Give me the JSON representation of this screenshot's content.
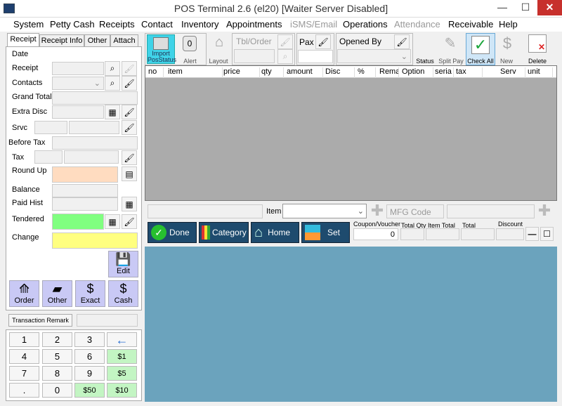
{
  "window": {
    "title": "POS Terminal 2.6 (el20) [Waiter Server Disabled]",
    "minimize": "—",
    "maximize": "☐",
    "close": "✕"
  },
  "menu": [
    "System",
    "Petty Cash",
    "Receipts",
    "Contact",
    "Inventory",
    "Appointments",
    "iSMS/Email",
    "Operations",
    "Attendance",
    "Receivable",
    "Help"
  ],
  "tabs": [
    "Receipt",
    "Receipt Info",
    "Other",
    "Attach"
  ],
  "left": {
    "date": "Date",
    "receipt": "Receipt",
    "contacts": "Contacts",
    "grand_total": "Grand Total",
    "extra_disc": "Extra Disc",
    "srvc": "Srvc",
    "before_tax": "Before Tax",
    "tax": "Tax",
    "round_up": "Round Up",
    "balance": "Balance",
    "paid_hist": "Paid Hist",
    "tendered": "Tendered",
    "change": "Change",
    "edit": "Edit"
  },
  "quick_buttons": [
    "Order",
    "Other",
    "Exact",
    "Cash"
  ],
  "transaction_remark": "Transaction Remark",
  "keypad": [
    "1",
    "2",
    "3",
    "←",
    "4",
    "5",
    "6",
    "$1",
    "7",
    "8",
    "9",
    "$5",
    ".",
    "0",
    "$50",
    "$10"
  ],
  "toolbar": {
    "import": "Import PosStatus",
    "alert": "Alert",
    "alert_count": "0",
    "layout": "Layout",
    "tbl_order": "Tbl/Order",
    "pax": "Pax",
    "opened_by": "Opened By",
    "status": "Status",
    "split_pay": "Split Pay",
    "check_all": "Check All",
    "new": "New",
    "delete": "Delete"
  },
  "grid_columns": [
    "no",
    "item",
    "price",
    "qty",
    "amount",
    "Disc",
    "%",
    "Rema",
    "Option",
    "seria",
    "tax",
    "Serv",
    "unit"
  ],
  "entry": {
    "item_label": "Item",
    "mfg_placeholder": "MFG Code"
  },
  "actions": {
    "done": "Done",
    "category": "Category",
    "home": "Home",
    "set": "Set"
  },
  "totals": {
    "coupon": "Coupon/Voucher",
    "coupon_value": "0",
    "total_qty": "Total Qty",
    "item_total": "Item Total",
    "total": "Total",
    "discount": "Discount"
  },
  "colors": {
    "accent": "#1e4b6e",
    "tendered": "#80ff80",
    "change": "#ffff80",
    "roundup": "#ffdcc0",
    "bluearea": "#6ba3bd"
  }
}
